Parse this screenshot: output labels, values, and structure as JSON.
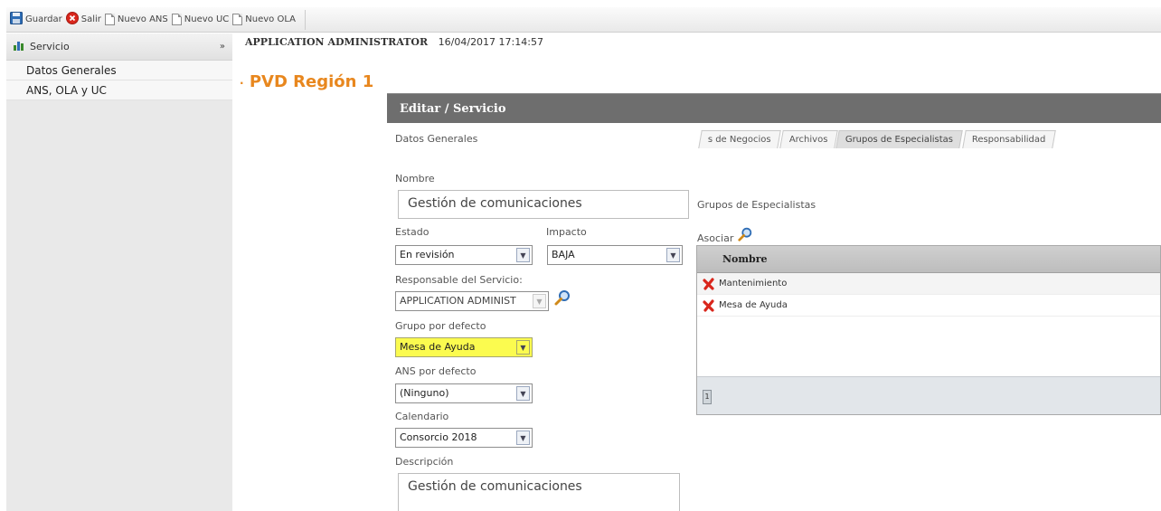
{
  "toolbar": {
    "save_label": "Guardar",
    "exit_label": "Salir",
    "new_ans_label": "Nuevo ANS",
    "new_uc_label": "Nuevo UC",
    "new_ola_label": "Nuevo OLA"
  },
  "sidebar": {
    "title": "Servicio",
    "items": [
      {
        "label": "Datos Generales"
      },
      {
        "label": "ANS, OLA y UC"
      }
    ]
  },
  "header": {
    "user": "APPLICATION ADMINISTRATOR",
    "timestamp": "16/04/2017 17:14:57"
  },
  "page_title": "PVD Región 1",
  "panel": {
    "title": "Editar / Servicio",
    "section_title": "Datos Generales",
    "tabs": [
      {
        "label": "s de Negocios"
      },
      {
        "label": "Archivos"
      },
      {
        "label": "Grupos de Especialistas"
      },
      {
        "label": "Responsabilidad"
      }
    ],
    "form": {
      "nombre_label": "Nombre",
      "nombre_value": "Gestión de comunicaciones",
      "estado_label": "Estado",
      "estado_value": "En revisión",
      "impacto_label": "Impacto",
      "impacto_value": "BAJA",
      "responsable_label": "Responsable del Servicio:",
      "responsable_value": "APPLICATION ADMINIST",
      "grupo_label": "Grupo por defecto",
      "grupo_value": "Mesa de Ayuda",
      "ans_label": "ANS por defecto",
      "ans_value": "(Ninguno)",
      "calendario_label": "Calendario",
      "calendario_value": "Consorcio 2018",
      "descripcion_label": "Descripción",
      "descripcion_value": "Gestión de comunicaciones"
    },
    "groups": {
      "title": "Grupos de Especialistas",
      "asociar_label": "Asociar",
      "column_header": "Nombre",
      "rows": [
        {
          "name": "Mantenimiento"
        },
        {
          "name": "Mesa de Ayuda"
        }
      ],
      "page": "1"
    }
  },
  "colors": {
    "accent_title": "#e8871e",
    "panel_header": "#6e6e6e",
    "highlight": "#fbfb4f"
  }
}
